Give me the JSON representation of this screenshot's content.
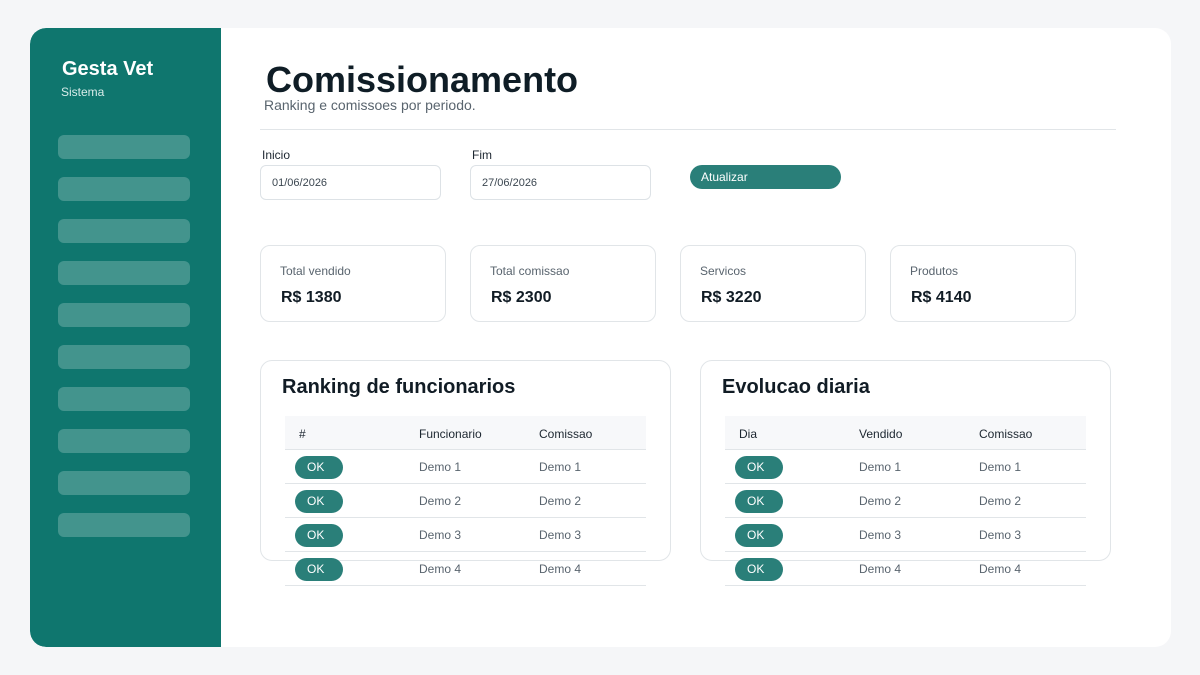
{
  "sidebar": {
    "brand": "Gesta Vet",
    "subtitle": "Sistema",
    "nav_count": 10
  },
  "header": {
    "title": "Comissionamento",
    "subtitle": "Ranking e comissoes por periodo."
  },
  "filters": {
    "start_label": "Inicio",
    "start_value": "01/06/2026",
    "end_label": "Fim",
    "end_value": "27/06/2026",
    "update_label": "Atualizar"
  },
  "kpis": [
    {
      "label": "Total vendido",
      "value": "R$ 1380"
    },
    {
      "label": "Total comissao",
      "value": "R$ 2300"
    },
    {
      "label": "Servicos",
      "value": "R$ 3220"
    },
    {
      "label": "Produtos",
      "value": "R$ 4140"
    }
  ],
  "ranking": {
    "title": "Ranking de funcionarios",
    "columns": [
      "#",
      "Funcionario",
      "Comissao"
    ],
    "rows": [
      {
        "badge": "OK",
        "c1": "Demo 1",
        "c2": "Demo 1"
      },
      {
        "badge": "OK",
        "c1": "Demo 2",
        "c2": "Demo 2"
      },
      {
        "badge": "OK",
        "c1": "Demo 3",
        "c2": "Demo 3"
      },
      {
        "badge": "OK",
        "c1": "Demo 4",
        "c2": "Demo 4"
      }
    ]
  },
  "daily": {
    "title": "Evolucao diaria",
    "columns": [
      "Dia",
      "Vendido",
      "Comissao"
    ],
    "rows": [
      {
        "badge": "OK",
        "c1": "Demo 1",
        "c2": "Demo 1"
      },
      {
        "badge": "OK",
        "c1": "Demo 2",
        "c2": "Demo 2"
      },
      {
        "badge": "OK",
        "c1": "Demo 3",
        "c2": "Demo 3"
      },
      {
        "badge": "OK",
        "c1": "Demo 4",
        "c2": "Demo 4"
      }
    ]
  },
  "colors": {
    "sidebar": "#0f766e",
    "accent": "#2a7f79"
  }
}
